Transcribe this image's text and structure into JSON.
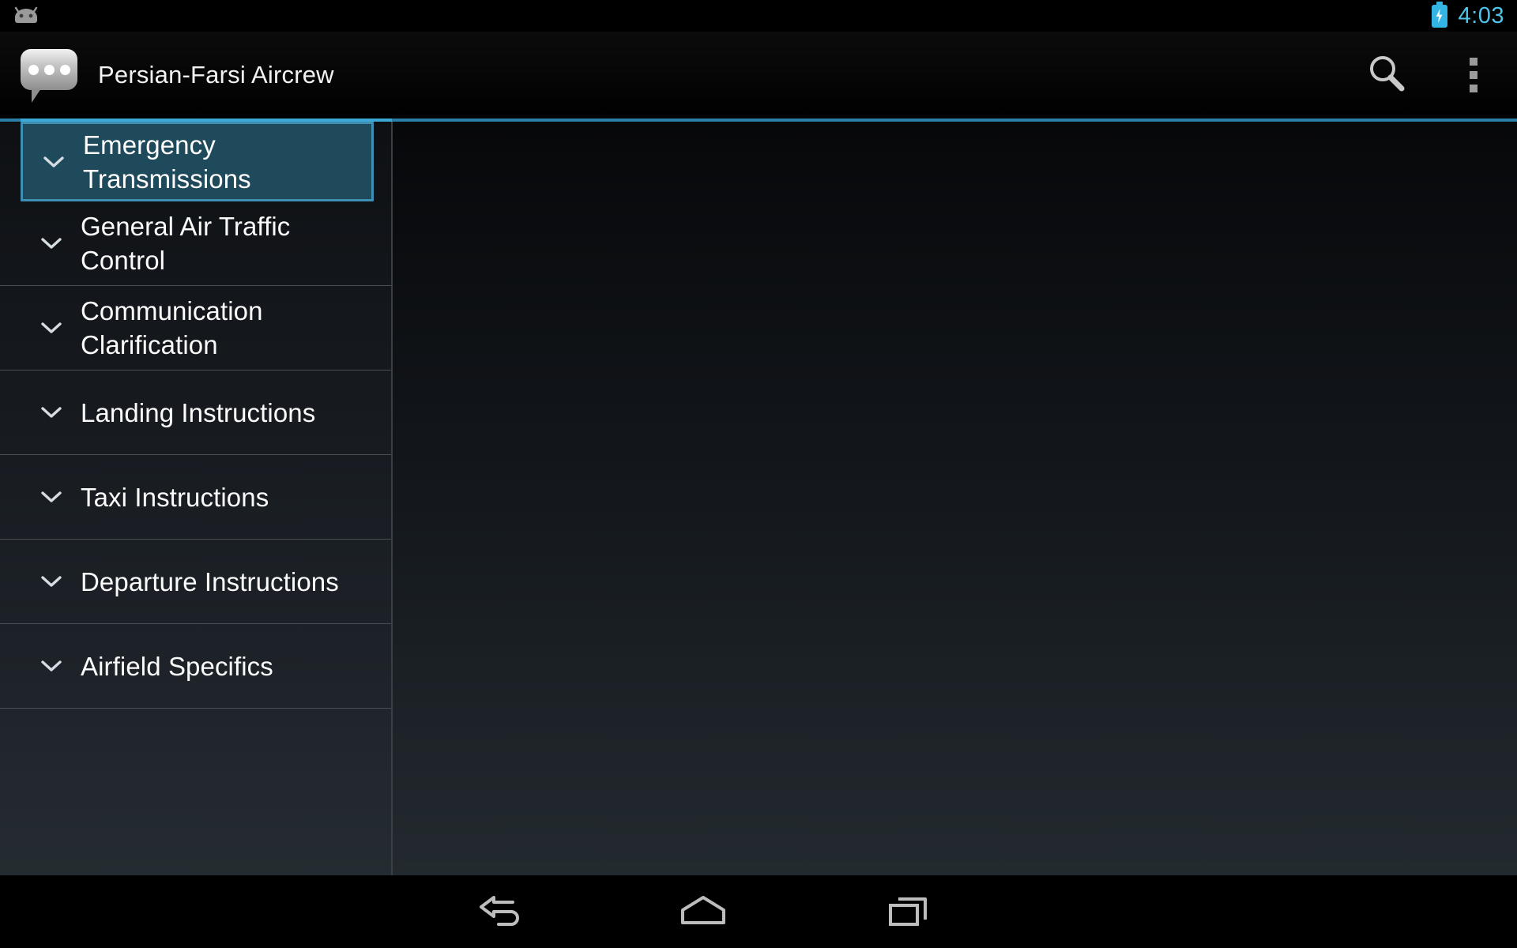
{
  "status_bar": {
    "android_icon": "android-head-icon",
    "battery_icon": "battery-charging-icon",
    "battery_color": "#33b5e5",
    "clock": "4:03",
    "clock_color": "#4fc3e8"
  },
  "action_bar": {
    "app_icon": "speech-bubble-icon",
    "title": "Persian-Farsi Aircrew",
    "search_icon": "search-icon",
    "overflow_icon": "overflow-menu-icon",
    "accent_color": "#3ba8d6"
  },
  "list": {
    "selected_index": 0,
    "selection_fill": "#1f4a5c",
    "selection_border": "#3e8fb3",
    "items": [
      {
        "label": "Emergency Transmissions",
        "expand_icon": "chevron-down-icon",
        "selected": true
      },
      {
        "label": "General Air Traffic Control",
        "expand_icon": "chevron-down-icon",
        "selected": false
      },
      {
        "label": "Communication Clarification",
        "expand_icon": "chevron-down-icon",
        "selected": false
      },
      {
        "label": "Landing Instructions",
        "expand_icon": "chevron-down-icon",
        "selected": false
      },
      {
        "label": "Taxi Instructions",
        "expand_icon": "chevron-down-icon",
        "selected": false
      },
      {
        "label": "Departure Instructions",
        "expand_icon": "chevron-down-icon",
        "selected": false
      },
      {
        "label": "Airfield Specifics",
        "expand_icon": "chevron-down-icon",
        "selected": false
      }
    ]
  },
  "detail": {
    "content": ""
  },
  "nav_bar": {
    "back_icon": "back-arrow-icon",
    "home_icon": "home-icon",
    "recents_icon": "recent-apps-icon"
  }
}
